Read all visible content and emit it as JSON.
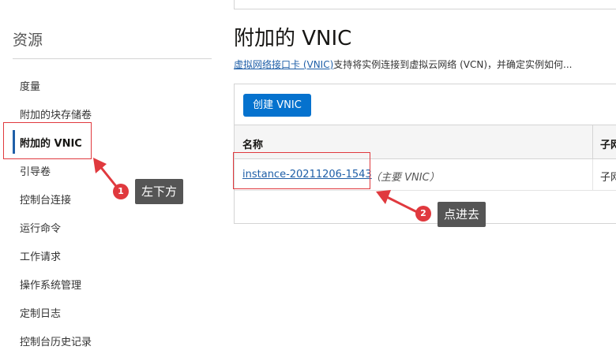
{
  "sidebar": {
    "title": "资源",
    "items": [
      {
        "label": "度量",
        "active": false
      },
      {
        "label": "附加的块存储卷",
        "active": false
      },
      {
        "label": "附加的 VNIC",
        "active": true
      },
      {
        "label": "引导卷",
        "active": false
      },
      {
        "label": "控制台连接",
        "active": false
      },
      {
        "label": "运行命令",
        "active": false
      },
      {
        "label": "工作请求",
        "active": false
      },
      {
        "label": "操作系统管理",
        "active": false
      },
      {
        "label": "定制日志",
        "active": false
      },
      {
        "label": "控制台历史记录",
        "active": false
      }
    ]
  },
  "main": {
    "title": "附加的 VNIC",
    "description_link": "虚拟网络接口卡 (VNIC)",
    "description_rest": "支持将实例连接到虚拟云网络 (VCN)，并确定实例如何...",
    "create_button": "创建 VNIC",
    "table": {
      "columns": [
        "名称",
        "子网"
      ],
      "rows": [
        {
          "name": "instance-20211206-1543",
          "tag": "（主要 VNIC）",
          "subnet": "子网"
        }
      ]
    }
  },
  "annotations": {
    "badge1": "1",
    "tip1": "左下方",
    "badge2": "2",
    "tip2": "点进去",
    "color": "#e0393e"
  }
}
